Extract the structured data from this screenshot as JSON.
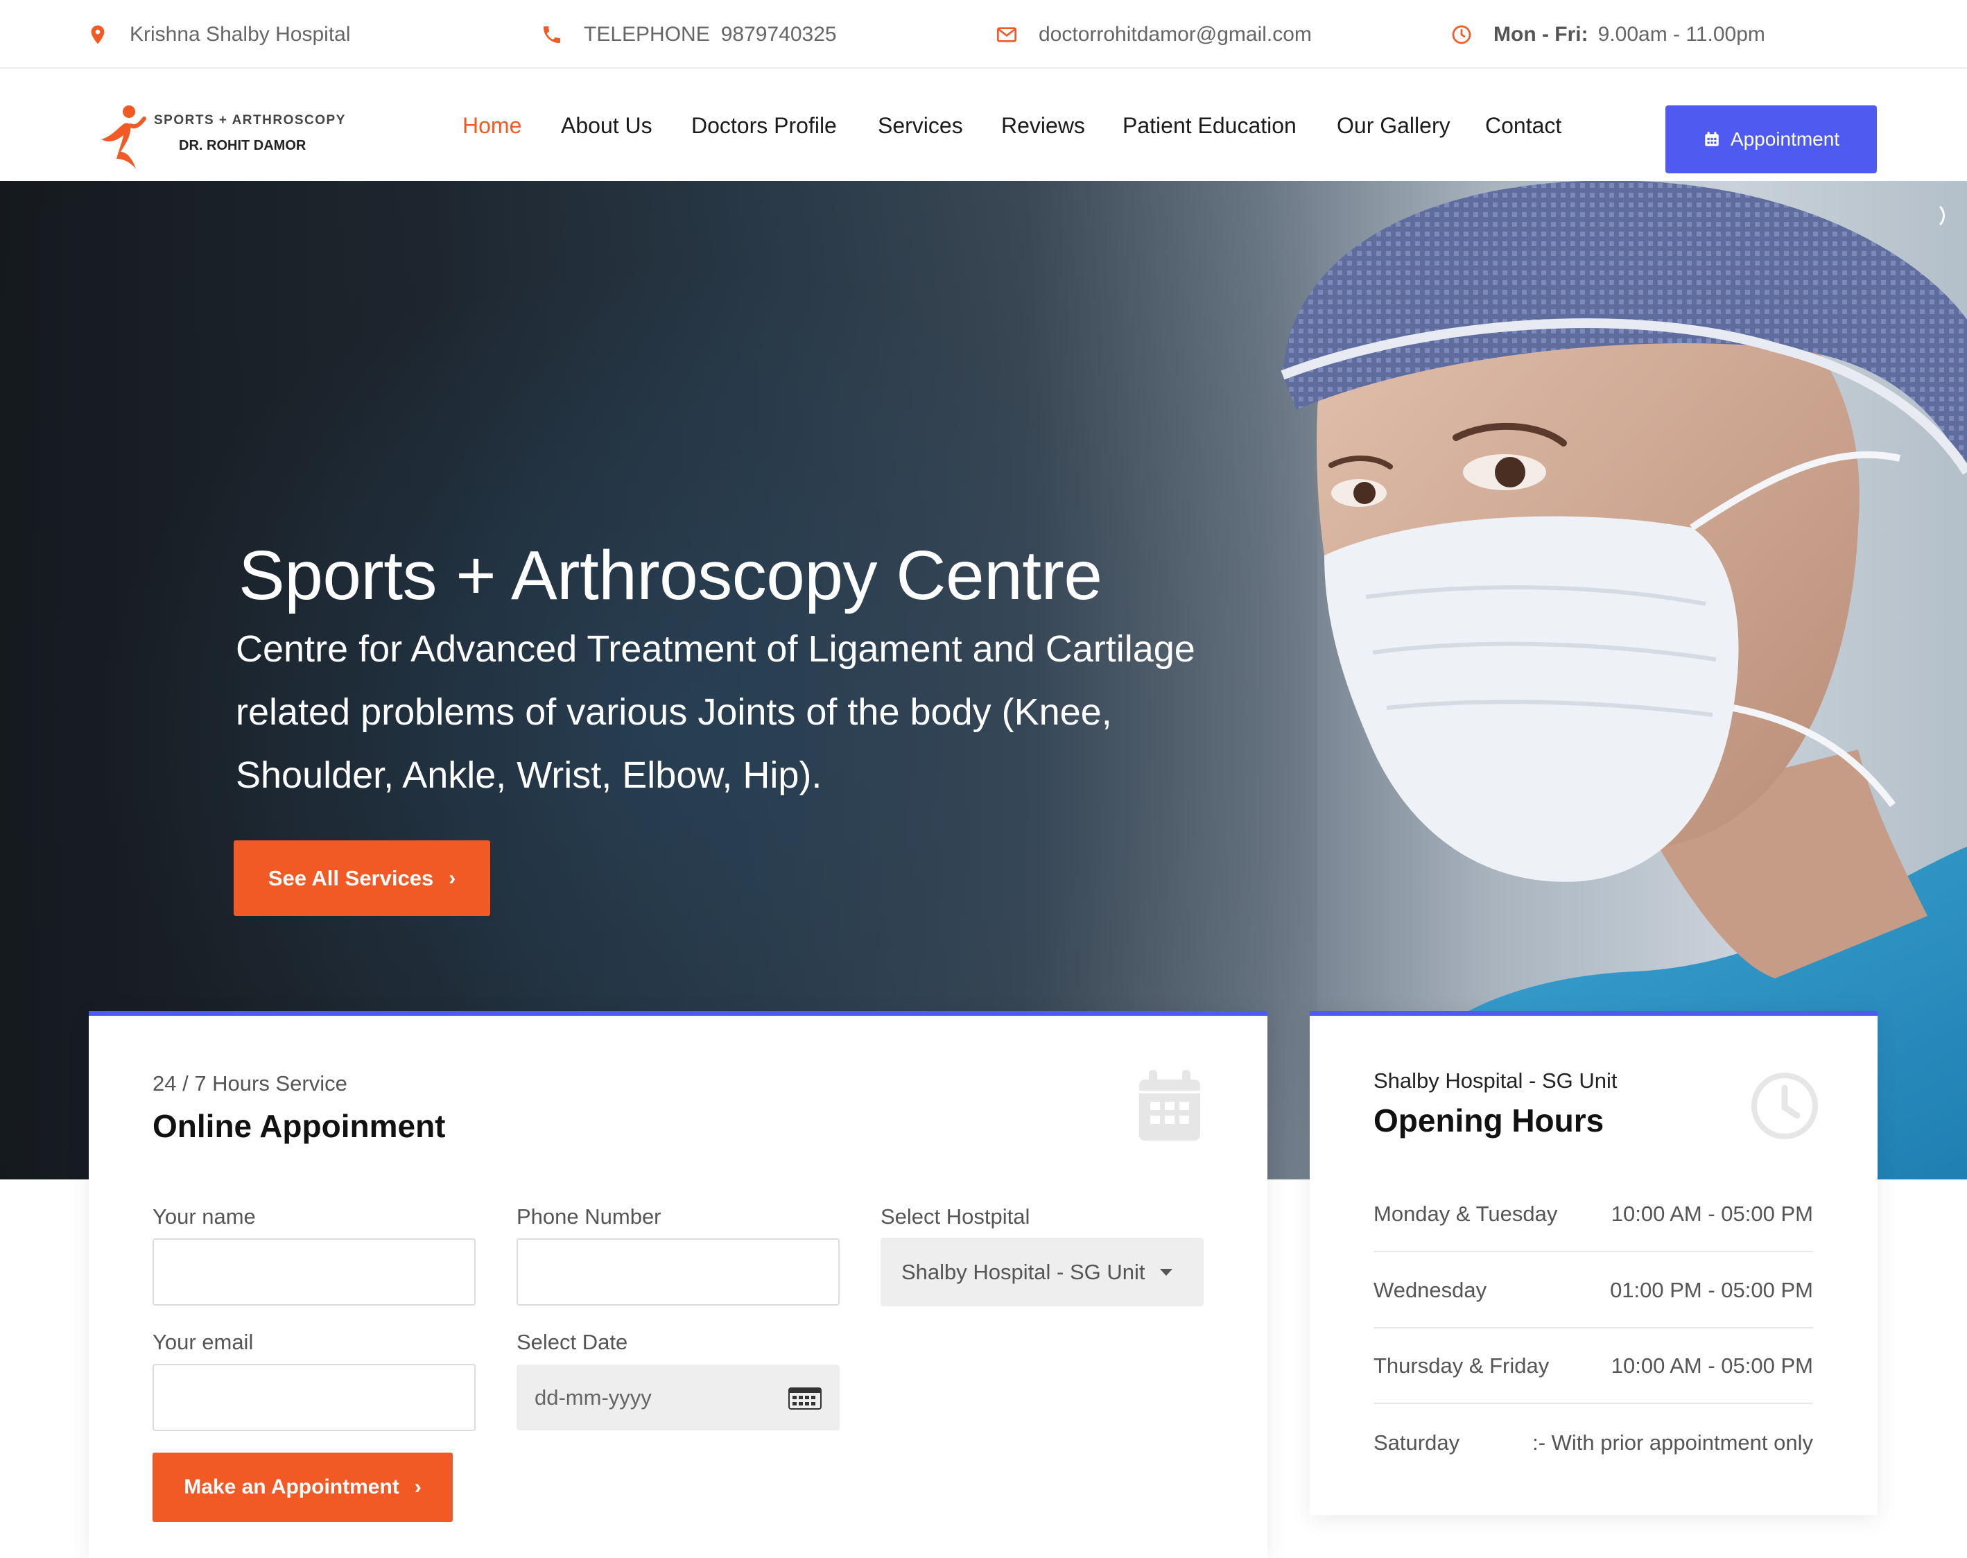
{
  "topbar": {
    "location": "Krishna Shalby Hospital",
    "telephone_label": "TELEPHONE",
    "telephone_number": "9879740325",
    "email": "doctorrohitdamor@gmail.com",
    "hours_days": "Mon - Fri:",
    "hours_time": "9.00am - 11.00pm"
  },
  "logo": {
    "line1": "SPORTS + ARTHROSCOPY",
    "line2": "DR. ROHIT DAMOR"
  },
  "nav": {
    "items": [
      {
        "label": "Home",
        "active": true
      },
      {
        "label": "About Us"
      },
      {
        "label": "Doctors Profile"
      },
      {
        "label": "Services"
      },
      {
        "label": "Reviews"
      },
      {
        "label": "Patient Education"
      },
      {
        "label": "Our Gallery"
      },
      {
        "label": "Contact"
      }
    ],
    "appointment_label": "Appointment"
  },
  "hero": {
    "heading": "Sports + Arthroscopy Centre",
    "subtext": "Centre for Advanced Treatment of Ligament and Cartilage related problems of various Joints of the body (Knee, Shoulder, Ankle, Wrist, Elbow, Hip).",
    "button_label": "See All Services"
  },
  "appointment_form": {
    "eyebrow": "24 / 7 Hours Service",
    "title": "Online Appoinment",
    "name_label": "Your name",
    "phone_label": "Phone Number",
    "hospital_label": "Select Hostpital",
    "hospital_selected": "Shalby Hospital - SG Unit",
    "email_label": "Your email",
    "date_label": "Select Date",
    "date_placeholder": "dd-mm-yyyy",
    "submit_label": "Make an Appointment"
  },
  "opening_hours": {
    "eyebrow": "Shalby Hospital - SG Unit",
    "title": "Opening Hours",
    "rows": [
      {
        "day": "Monday & Tuesday",
        "time": "10:00 AM - 05:00 PM"
      },
      {
        "day": "Wednesday",
        "time": "01:00 PM - 05:00 PM"
      },
      {
        "day": "Thursday & Friday",
        "time": "10:00 AM - 05:00 PM"
      },
      {
        "day": "Saturday",
        "time": ":- With prior appointment only"
      }
    ]
  },
  "colors": {
    "accent_orange": "#f15a24",
    "accent_blue": "#4f5bf0"
  }
}
